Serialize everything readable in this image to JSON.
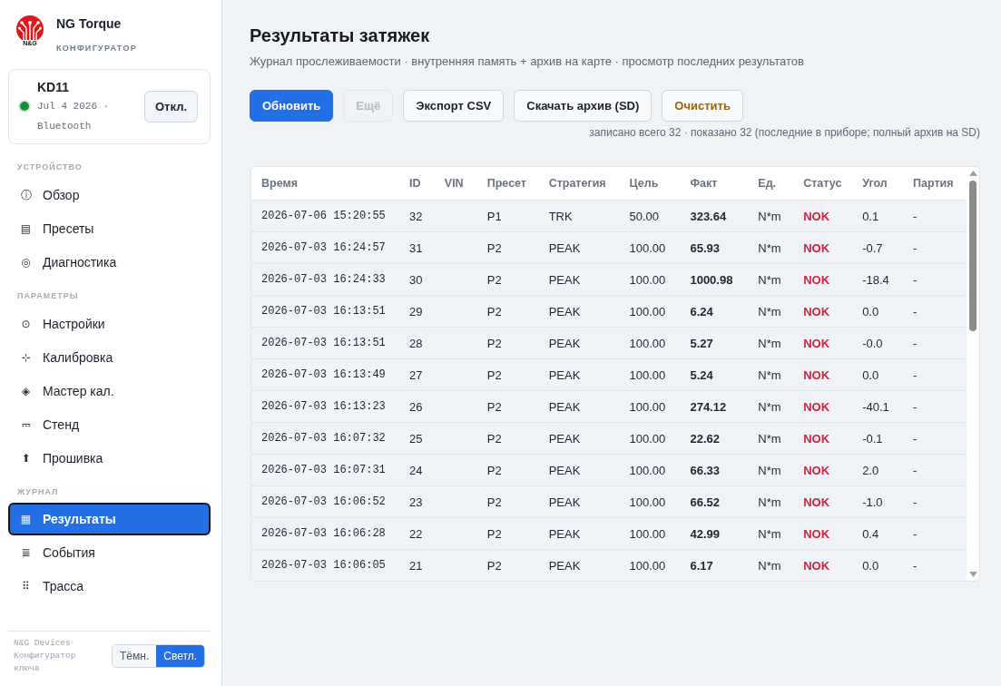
{
  "sidebar": {
    "logo_text": "N&G",
    "app_name": "NG Torque",
    "app_subtitle": "КОНФИГУРАТОР",
    "device": {
      "name": "KD11",
      "connected": true,
      "info": "Jul 4 2026 · Bluetooth",
      "disconnect_button": "Откл."
    },
    "sections": [
      {
        "title": "УСТРОЙСТВО",
        "items": [
          {
            "icon": "ⓘ",
            "label": "Обзор",
            "selected": false
          },
          {
            "icon": "▤",
            "label": "Пресеты",
            "selected": false
          },
          {
            "icon": "◎",
            "label": "Диагностика",
            "selected": false
          }
        ]
      },
      {
        "title": "ПАРАМЕТРЫ",
        "items": [
          {
            "icon": "⊙",
            "label": "Настройки",
            "selected": false
          },
          {
            "icon": "⊹",
            "label": "Калибровка",
            "selected": false
          },
          {
            "icon": "◈",
            "label": "Мастер кал.",
            "selected": false
          },
          {
            "icon": "⎓",
            "label": "Стенд",
            "selected": false
          },
          {
            "icon": "⬆",
            "label": "Прошивка",
            "selected": false
          }
        ]
      },
      {
        "title": "ЖУРНАЛ",
        "items": [
          {
            "icon": "▦",
            "label": "Результаты",
            "selected": true
          },
          {
            "icon": "≣",
            "label": "События",
            "selected": false
          },
          {
            "icon": "⠿",
            "label": "Трасса",
            "selected": false
          }
        ]
      }
    ],
    "footer": {
      "text": "N&G Devices Конфигуратор ключа",
      "theme_toggle": [
        {
          "label": "Тёмн.",
          "selected": false
        },
        {
          "label": "Светл.",
          "selected": true
        }
      ]
    }
  },
  "main": {
    "title": "Результаты затяжек",
    "subtitle": "Журнал прослеживаемости · внутренняя память + архив на карте · просмотр последних результатов",
    "buttons": [
      {
        "label": "Обновить",
        "kind": "primary",
        "disabled": false
      },
      {
        "label": "Ещё",
        "kind": "default",
        "disabled": true
      },
      {
        "label": "Экспорт CSV",
        "kind": "default",
        "disabled": false
      },
      {
        "label": "Скачать архив (SD)",
        "kind": "default",
        "disabled": false
      },
      {
        "label": "Очистить",
        "kind": "warning",
        "disabled": false
      }
    ],
    "note": "записано всего 32 · показано 32 (последние в приборе; полный архив на SD)",
    "table": {
      "columns": [
        "Время",
        "ID",
        "VIN",
        "Пресет",
        "Стратегия",
        "Цель",
        "Факт",
        "Ед.",
        "Статус",
        "Угол",
        "Партия"
      ],
      "rows": [
        {
          "time": "2026-07-06 15:20:55",
          "id": "32",
          "preset": "P1",
          "strategy": "TRK",
          "target": "50.00",
          "actual": "323.64",
          "unit": "N*m",
          "status": "NOK",
          "status_ok": false,
          "angle": "0.1",
          "batch": "-"
        },
        {
          "time": "2026-07-03 16:24:57",
          "id": "31",
          "preset": "P2",
          "strategy": "PEAK",
          "target": "100.00",
          "actual": "65.93",
          "unit": "N*m",
          "status": "NOK",
          "status_ok": false,
          "angle": "-0.7",
          "batch": "-"
        },
        {
          "time": "2026-07-03 16:24:33",
          "id": "30",
          "preset": "P2",
          "strategy": "PEAK",
          "target": "100.00",
          "actual": "1000.98",
          "unit": "N*m",
          "status": "NOK",
          "status_ok": false,
          "angle": "-18.4",
          "batch": "-"
        },
        {
          "time": "2026-07-03 16:13:51",
          "id": "29",
          "preset": "P2",
          "strategy": "PEAK",
          "target": "100.00",
          "actual": "6.24",
          "unit": "N*m",
          "status": "NOK",
          "status_ok": false,
          "angle": "0.0",
          "batch": "-"
        },
        {
          "time": "2026-07-03 16:13:51",
          "id": "28",
          "preset": "P2",
          "strategy": "PEAK",
          "target": "100.00",
          "actual": "5.27",
          "unit": "N*m",
          "status": "NOK",
          "status_ok": false,
          "angle": "-0.0",
          "batch": "-"
        },
        {
          "time": "2026-07-03 16:13:49",
          "id": "27",
          "preset": "P2",
          "strategy": "PEAK",
          "target": "100.00",
          "actual": "5.24",
          "unit": "N*m",
          "status": "NOK",
          "status_ok": false,
          "angle": "0.0",
          "batch": "-"
        },
        {
          "time": "2026-07-03 16:13:23",
          "id": "26",
          "preset": "P2",
          "strategy": "PEAK",
          "target": "100.00",
          "actual": "274.12",
          "unit": "N*m",
          "status": "NOK",
          "status_ok": false,
          "angle": "-40.1",
          "batch": "-"
        },
        {
          "time": "2026-07-03 16:07:32",
          "id": "25",
          "preset": "P2",
          "strategy": "PEAK",
          "target": "100.00",
          "actual": "22.62",
          "unit": "N*m",
          "status": "NOK",
          "status_ok": false,
          "angle": "-0.1",
          "batch": "-"
        },
        {
          "time": "2026-07-03 16:07:31",
          "id": "24",
          "preset": "P2",
          "strategy": "PEAK",
          "target": "100.00",
          "actual": "66.33",
          "unit": "N*m",
          "status": "NOK",
          "status_ok": false,
          "angle": "2.0",
          "batch": "-"
        },
        {
          "time": "2026-07-03 16:06:52",
          "id": "23",
          "preset": "P2",
          "strategy": "PEAK",
          "target": "100.00",
          "actual": "66.52",
          "unit": "N*m",
          "status": "NOK",
          "status_ok": false,
          "angle": "-1.0",
          "batch": "-"
        },
        {
          "time": "2026-07-03 16:06:28",
          "id": "22",
          "preset": "P2",
          "strategy": "PEAK",
          "target": "100.00",
          "actual": "42.99",
          "unit": "N*m",
          "status": "NOK",
          "status_ok": false,
          "angle": "0.4",
          "batch": "-"
        },
        {
          "time": "2026-07-03 16:06:05",
          "id": "21",
          "preset": "P2",
          "strategy": "PEAK",
          "target": "100.00",
          "actual": "6.17",
          "unit": "N*m",
          "status": "NOK",
          "status_ok": false,
          "angle": "0.0",
          "batch": "-"
        }
      ]
    }
  }
}
